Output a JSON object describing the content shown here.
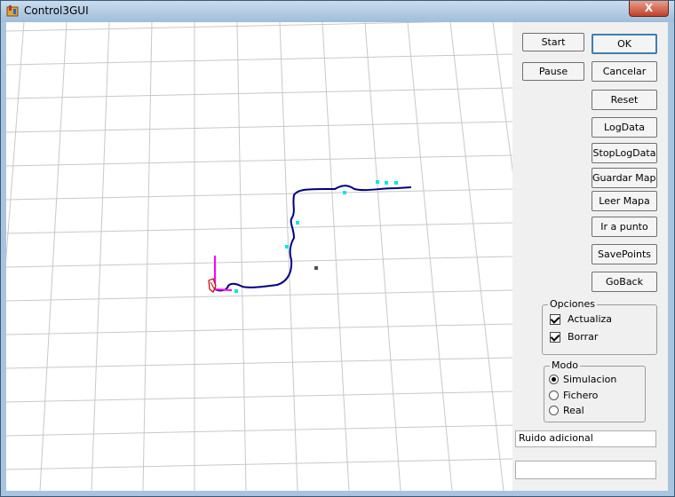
{
  "window": {
    "title": "Control3GUI",
    "close_label": "X"
  },
  "buttons": {
    "start": "Start",
    "pause": "Pause",
    "ok": "OK",
    "cancelar": "Cancelar",
    "reset": "Reset",
    "logdata": "LogData",
    "stoplogdata": "StopLogData",
    "guardar_mapa": "Guardar Mapa",
    "leer_mapa": "Leer Mapa",
    "ir_a_punto": "Ir a punto",
    "savepoints": "SavePoints",
    "goback": "GoBack"
  },
  "opciones": {
    "title": "Opciones",
    "items": [
      {
        "label": "Actualiza",
        "checked": true
      },
      {
        "label": "Borrar",
        "checked": true
      }
    ]
  },
  "modo": {
    "title": "Modo",
    "options": [
      {
        "label": "Simulacion",
        "selected": true
      },
      {
        "label": "Fichero",
        "selected": false
      },
      {
        "label": "Real",
        "selected": false
      }
    ]
  },
  "fields": {
    "ruido_value": "Ruido adicional",
    "extra_value": ""
  },
  "colors": {
    "grid": "#c8c8c8",
    "path": "#000080",
    "robot_heading": "#ff00ff",
    "landmarks": "#00e5e5",
    "target": "#505050"
  }
}
